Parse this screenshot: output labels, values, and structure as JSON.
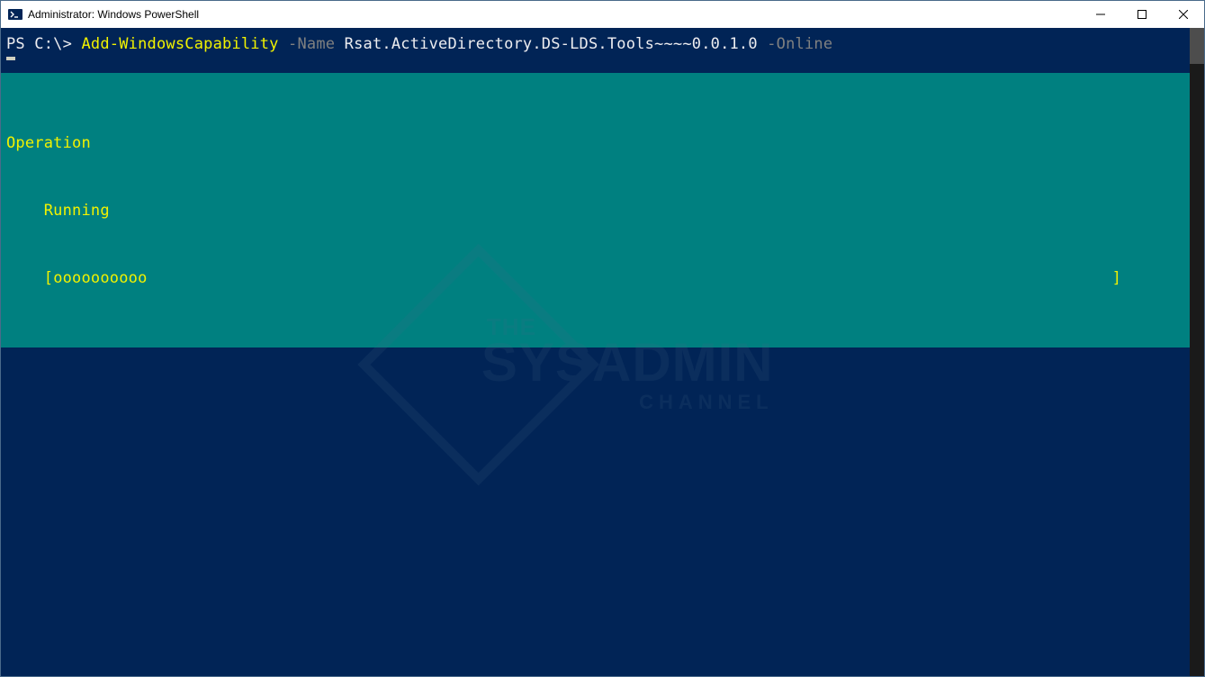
{
  "window": {
    "title": "Administrator: Windows PowerShell"
  },
  "command": {
    "prompt": "PS C:\\> ",
    "cmdlet": "Add-WindowsCapability",
    "param_name_flag": " -Name ",
    "param_name_value": "Rsat.ActiveDirectory.DS-LDS.Tools~~~~0.0.1.0",
    "param_online_flag": " -Online"
  },
  "progress": {
    "title": "Operation",
    "status": "    Running",
    "bar_indent": "    ",
    "bar_open": "[",
    "bar_fill": "oooooooooo",
    "bar_close": "]"
  },
  "watermark": {
    "line1": "THE",
    "line2": "SYSADMIN",
    "line3": "CHANNEL"
  }
}
